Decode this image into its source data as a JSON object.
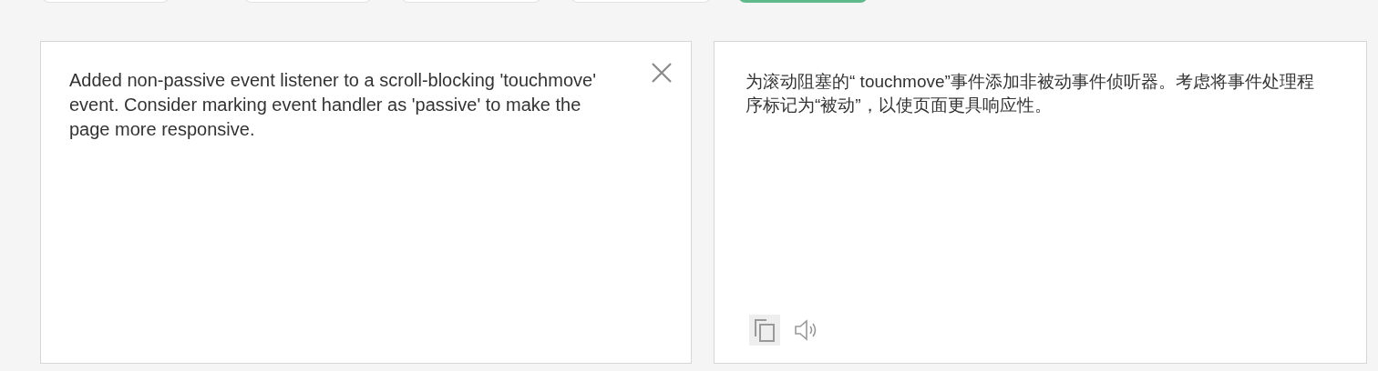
{
  "top_buttons": [
    {
      "selected": false
    },
    {
      "selected": false
    },
    {
      "selected": false
    },
    {
      "selected": false
    },
    {
      "selected": true
    }
  ],
  "source": {
    "text": "Added non-passive event listener to a scroll-blocking 'touchmove' event. Consider marking event handler as 'passive' to make the page more responsive."
  },
  "result": {
    "text": "为滚动阻塞的“ touchmove”事件添加非被动事件侦听器。考虑将事件处理程序标记为“被动”，以使页面更具响应性。",
    "copy_hovered": true
  }
}
